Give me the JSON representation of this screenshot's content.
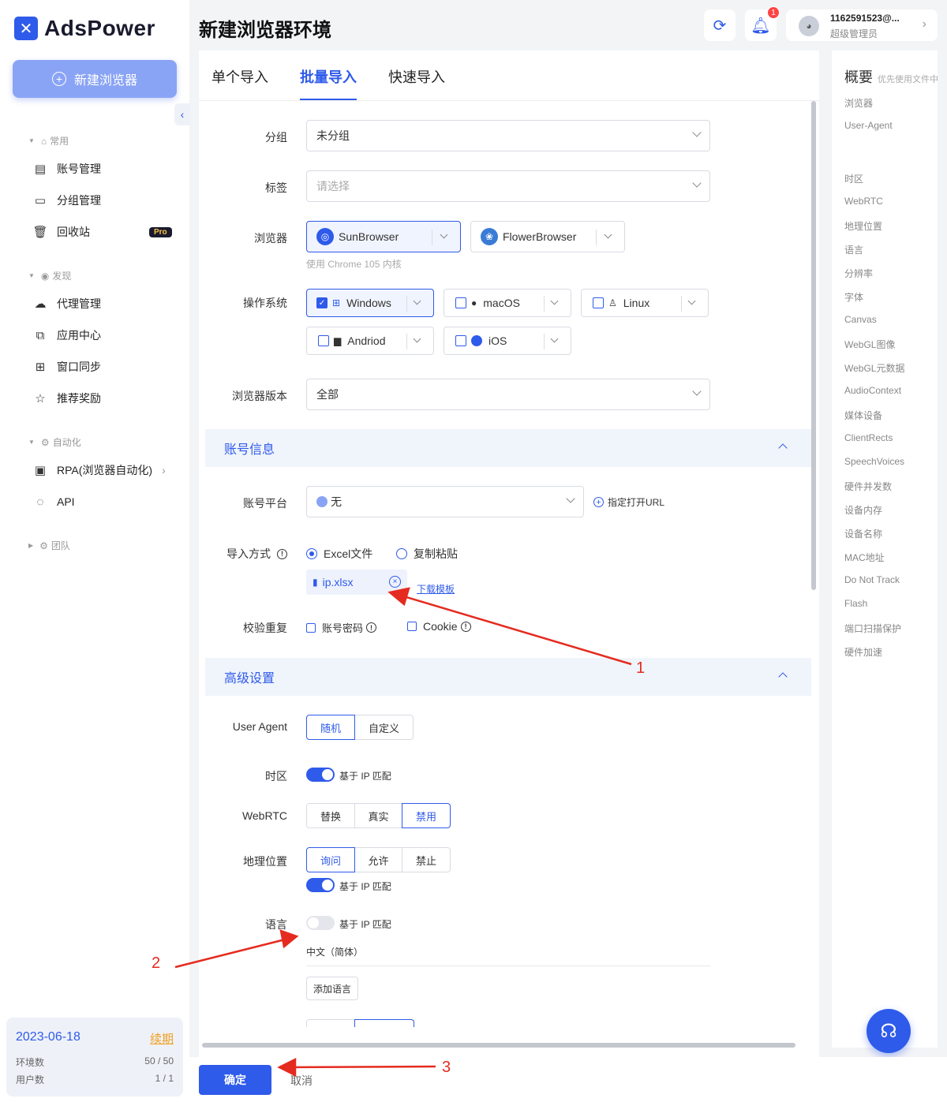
{
  "app": {
    "name": "AdsPower",
    "logo_glyph": "✕"
  },
  "sidebar": {
    "new_button": "新建浏览器",
    "sections": [
      {
        "title": "常用",
        "items": [
          {
            "label": "账号管理",
            "icon": "account-list-icon"
          },
          {
            "label": "分组管理",
            "icon": "folder-icon"
          },
          {
            "label": "回收站",
            "icon": "trash-icon",
            "badge": "Pro"
          }
        ]
      },
      {
        "title": "发现",
        "items": [
          {
            "label": "代理管理",
            "icon": "proxy-icon"
          },
          {
            "label": "应用中心",
            "icon": "app-center-icon"
          },
          {
            "label": "窗口同步",
            "icon": "window-sync-icon"
          },
          {
            "label": "推荐奖励",
            "icon": "star-icon"
          }
        ]
      },
      {
        "title": "自动化",
        "items": [
          {
            "label": "RPA(浏览器自动化)",
            "icon": "rpa-icon"
          },
          {
            "label": "API",
            "icon": "api-icon"
          }
        ]
      },
      {
        "title": "团队",
        "items": []
      }
    ],
    "expiry": {
      "date": "2023-06-18",
      "renew": "续期",
      "env_label": "环境数",
      "env_value": "50 / 50",
      "user_label": "用户数",
      "user_value": "1 / 1"
    }
  },
  "header": {
    "title": "新建浏览器环境",
    "notification_count": "1",
    "user_name": "1162591523@...",
    "user_role": "超级管理员"
  },
  "tabs": [
    "单个导入",
    "批量导入",
    "快速导入"
  ],
  "form": {
    "group": {
      "label": "分组",
      "value": "未分组"
    },
    "tags": {
      "label": "标签",
      "placeholder": "请选择"
    },
    "browser": {
      "label": "浏览器",
      "options": [
        "SunBrowser",
        "FlowerBrowser"
      ],
      "hint": "使用 Chrome 105 内核"
    },
    "os": {
      "label": "操作系统",
      "options": [
        "Windows",
        "macOS",
        "Linux",
        "Andriod",
        "iOS"
      ]
    },
    "browser_version": {
      "label": "浏览器版本",
      "value": "全部"
    },
    "account_section": "账号信息",
    "platform": {
      "label": "账号平台",
      "value": "无",
      "link": "指定打开URL"
    },
    "import_method": {
      "label": "导入方式",
      "options": [
        "Excel文件",
        "复制粘贴"
      ],
      "file": "ip.xlsx",
      "download": "下载模板"
    },
    "dedupe": {
      "label": "校验重复",
      "options": [
        "账号密码",
        "Cookie"
      ]
    },
    "advanced_section": "高级设置",
    "user_agent": {
      "label": "User Agent",
      "options": [
        "随机",
        "自定义"
      ]
    },
    "timezone": {
      "label": "时区",
      "toggle_text": "基于 IP 匹配"
    },
    "webrtc": {
      "label": "WebRTC",
      "options": [
        "替换",
        "真实",
        "禁用"
      ]
    },
    "geo": {
      "label": "地理位置",
      "options": [
        "询问",
        "允许",
        "禁止"
      ],
      "toggle_text": "基于 IP 匹配"
    },
    "language": {
      "label": "语言",
      "toggle_text": "基于 IP 匹配",
      "value": "中文（简体）",
      "add": "添加语言"
    }
  },
  "overview": {
    "title": "概要",
    "subtitle": "优先使用文件中",
    "items": [
      "浏览器",
      "User-Agent",
      "时区",
      "WebRTC",
      "地理位置",
      "语言",
      "分辨率",
      "字体",
      "Canvas",
      "WebGL图像",
      "WebGL元数据",
      "AudioContext",
      "媒体设备",
      "ClientRects",
      "SpeechVoices",
      "硬件并发数",
      "设备内存",
      "设备名称",
      "MAC地址",
      "Do Not Track",
      "Flash",
      "端口扫描保护",
      "硬件加速"
    ]
  },
  "footer": {
    "confirm": "确定",
    "cancel": "取消"
  },
  "annotations": [
    "1",
    "2",
    "3"
  ],
  "colors": {
    "accent": "#2f5bea",
    "annotation": "#e52b1f"
  }
}
